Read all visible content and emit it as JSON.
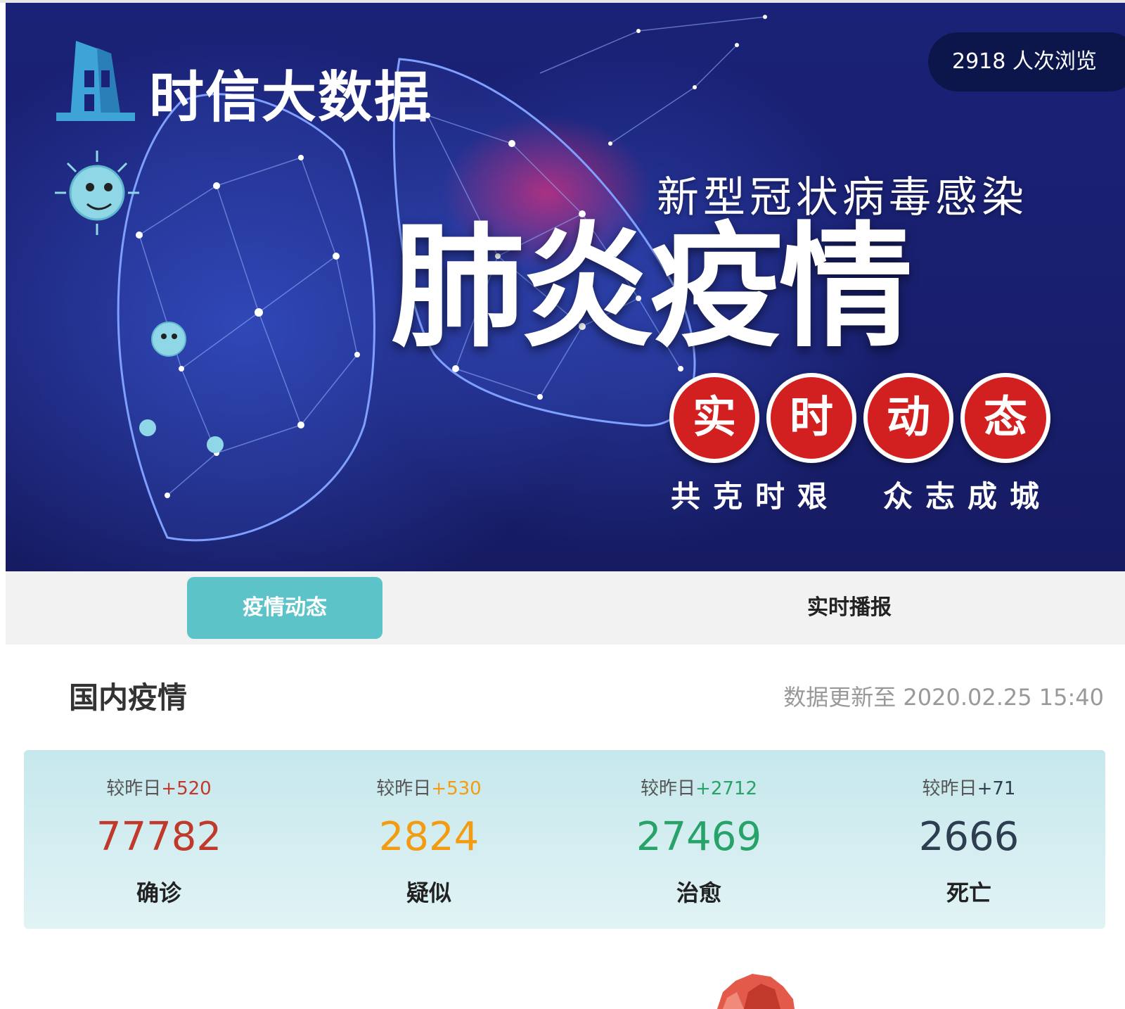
{
  "banner": {
    "logo_text": "时信大数据",
    "views_count": "2918",
    "views_suffix": "人次浏览",
    "subtitle": "新型冠状病毒感染",
    "main_title": "肺炎疫情",
    "badges": [
      "实",
      "时",
      "动",
      "态"
    ],
    "slogan_left": "共克时艰",
    "slogan_right": "众志成城"
  },
  "tabs": [
    {
      "label": "疫情动态",
      "active": true
    },
    {
      "label": "实时播报",
      "active": false
    }
  ],
  "section": {
    "title": "国内疫情",
    "updated_prefix": "数据更新至",
    "updated_time": "2020.02.25 15:40"
  },
  "stats": [
    {
      "delta_prefix": "较昨日",
      "delta": "+520",
      "value": "77782",
      "label": "确诊",
      "color": "#c0392b"
    },
    {
      "delta_prefix": "较昨日",
      "delta": "+530",
      "value": "2824",
      "label": "疑似",
      "color": "#f39c12"
    },
    {
      "delta_prefix": "较昨日",
      "delta": "+2712",
      "value": "27469",
      "label": "治愈",
      "color": "#27a36a"
    },
    {
      "delta_prefix": "较昨日",
      "delta": "+71",
      "value": "2666",
      "label": "死亡",
      "color": "#2c3e50"
    }
  ],
  "colors": {
    "accent_tab": "#5cc3c8",
    "badge_red": "#d21f1f",
    "banner_bg": "#1a2277"
  }
}
